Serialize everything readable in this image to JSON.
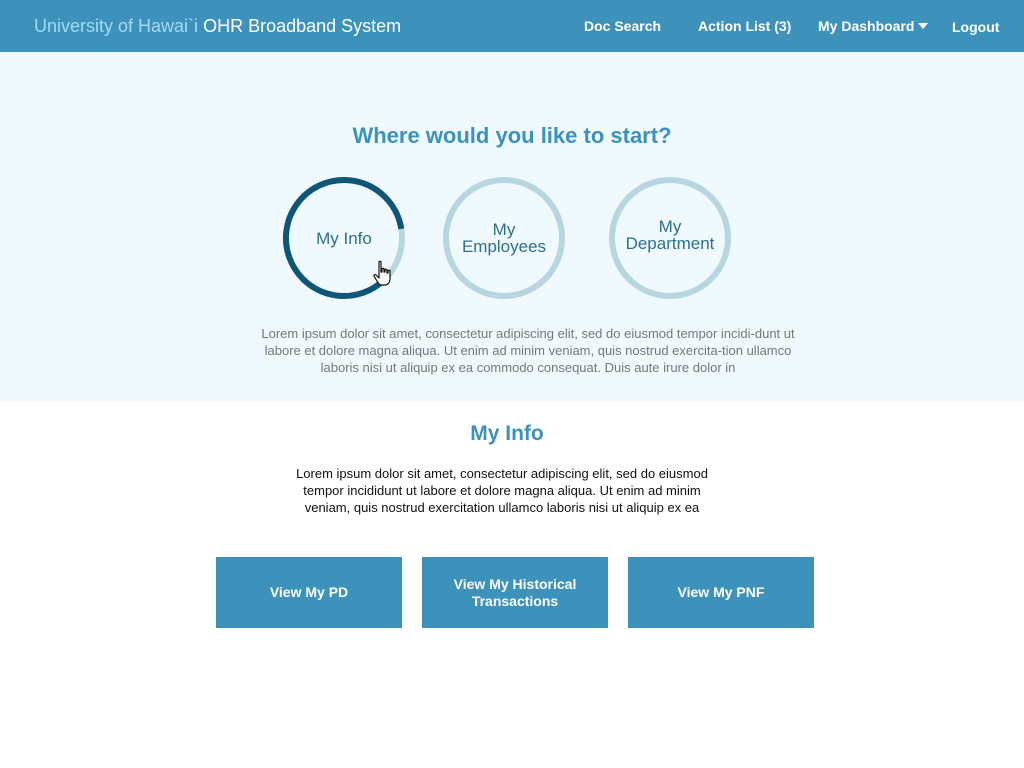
{
  "header": {
    "brand_university": "University of Hawai`i",
    "brand_system": "OHR Broadband System",
    "nav": {
      "doc_search": "Doc Search",
      "action_list": "Action List (3)",
      "my_dashboard": "My Dashboard",
      "logout": "Logout"
    }
  },
  "hero": {
    "title": "Where would you like to start?",
    "options": [
      {
        "line1": "My Info",
        "line2": ""
      },
      {
        "line1": "My",
        "line2": "Employees"
      },
      {
        "line1": "My",
        "line2": "Department"
      }
    ],
    "description": "Lorem ipsum dolor sit amet, consectetur adipiscing elit, sed do eiusmod tempor incidi-dunt ut labore et dolore magna aliqua. Ut enim ad minim veniam, quis nostrud exercita-tion ullamco laboris nisi ut aliquip ex ea commodo consequat. Duis aute irure dolor in"
  },
  "section": {
    "title": "My Info",
    "description": "Lorem ipsum dolor sit amet, consectetur adipiscing elit, sed do eiusmod tempor incididunt ut labore et dolore magna aliqua. Ut enim ad minim veniam, quis nostrud exercitation ullamco laboris nisi ut aliquip ex ea",
    "buttons": {
      "view_pd": "View My PD",
      "view_historical": "View My Historical Transactions",
      "view_pnf": "View My PNF"
    }
  },
  "colors": {
    "header_bg": "#3d92bb",
    "brand_light": "#a3d9f3",
    "hero_bg": "#f0f9fd",
    "accent": "#3d92bb",
    "ring_active": "#0f5676",
    "ring_inactive": "#b8d6e2",
    "button_bg": "#3d92bb"
  },
  "icons": {
    "cursor": "hand-pointer-icon",
    "dropdown": "caret-down-icon"
  }
}
